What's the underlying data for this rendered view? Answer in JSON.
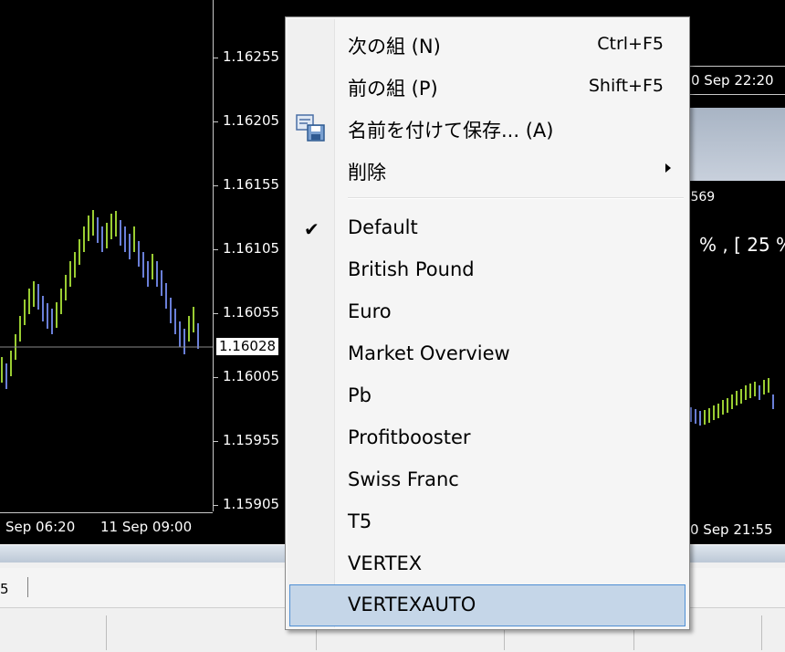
{
  "main_chart": {
    "price_labels": [
      "1.16255",
      "1.16205",
      "1.16155",
      "1.16105",
      "1.16055",
      "1.16005",
      "1.15955",
      "1.15905"
    ],
    "current_price": "1.16028",
    "time_labels": [
      "Sep 06:20",
      "11 Sep 09:00"
    ]
  },
  "right_chart": {
    "time_top": "0 Sep 22:20",
    "value_label": ".569",
    "percent_text": "% , [ 25 %",
    "time_bottom": "0 Sep 21:55"
  },
  "bottom": {
    "tab_fragment": "5",
    "status_profile": "Default"
  },
  "context_menu": {
    "items": [
      {
        "label": "次の組 (N)",
        "shortcut": "Ctrl+F5"
      },
      {
        "label": "前の組 (P)",
        "shortcut": "Shift+F5"
      },
      {
        "label": "名前を付けて保存... (A)",
        "icon": "save-profile-icon"
      },
      {
        "label": "削除",
        "has_submenu": true
      },
      {
        "label": "Default",
        "checked": true
      },
      {
        "label": "British Pound"
      },
      {
        "label": "Euro"
      },
      {
        "label": "Market Overview"
      },
      {
        "label": "Pb"
      },
      {
        "label": "Profitbooster"
      },
      {
        "label": "Swiss Franc"
      },
      {
        "label": "T5"
      },
      {
        "label": "VERTEX"
      },
      {
        "label": "VERTEXAUTO",
        "selected": true
      }
    ]
  },
  "colors": {
    "bull_bar": "#9ACD32",
    "bear_bar": "#6A7FD8",
    "menu_highlight": "#C5D6E8",
    "menu_highlight_border": "#4F8FD4"
  }
}
